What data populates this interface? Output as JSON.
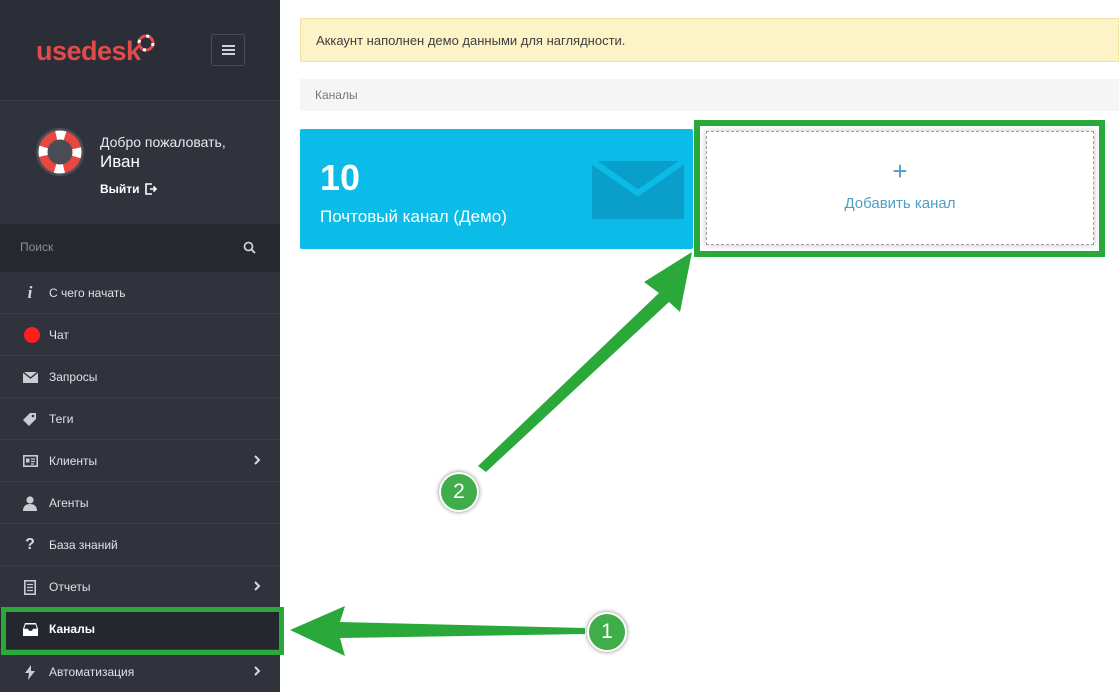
{
  "brand": {
    "logo_text": "usedesk"
  },
  "user": {
    "welcome": "Добро пожаловать,",
    "name": "Иван",
    "logout_label": "Выйти"
  },
  "search": {
    "placeholder": "Поиск"
  },
  "sidebar": {
    "items": [
      {
        "label": "С чего начать",
        "icon": "info-icon"
      },
      {
        "label": "Чат",
        "icon": "status-dot-icon"
      },
      {
        "label": "Запросы",
        "icon": "envelope-icon"
      },
      {
        "label": "Теги",
        "icon": "tag-icon"
      },
      {
        "label": "Клиенты",
        "icon": "id-card-icon",
        "has_submenu": true
      },
      {
        "label": "Агенты",
        "icon": "user-icon"
      },
      {
        "label": "База знаний",
        "icon": "question-icon"
      },
      {
        "label": "Отчеты",
        "icon": "document-icon",
        "has_submenu": true
      },
      {
        "label": "Каналы",
        "icon": "inbox-icon",
        "active": true
      },
      {
        "label": "Автоматизация",
        "icon": "bolt-icon",
        "has_submenu": true
      }
    ]
  },
  "notice": {
    "text": "Аккаунт наполнен демо данными для наглядности."
  },
  "breadcrumb": {
    "current": "Каналы"
  },
  "channels": [
    {
      "count": "10",
      "label": "Почтовый канал (Демо)",
      "icon": "envelope-icon"
    }
  ],
  "add_channel": {
    "plus": "+",
    "label": "Добавить канал"
  },
  "annotations": {
    "badge_1": "1",
    "badge_2": "2"
  },
  "colors": {
    "sidebar_bg": "#2f323b",
    "accent_cyan": "#0bbce8",
    "highlight_green": "#2aa83a",
    "link_blue": "#4e9ec6",
    "notice_bg": "#fcf3c6",
    "logo_red": "#e34a4a"
  }
}
